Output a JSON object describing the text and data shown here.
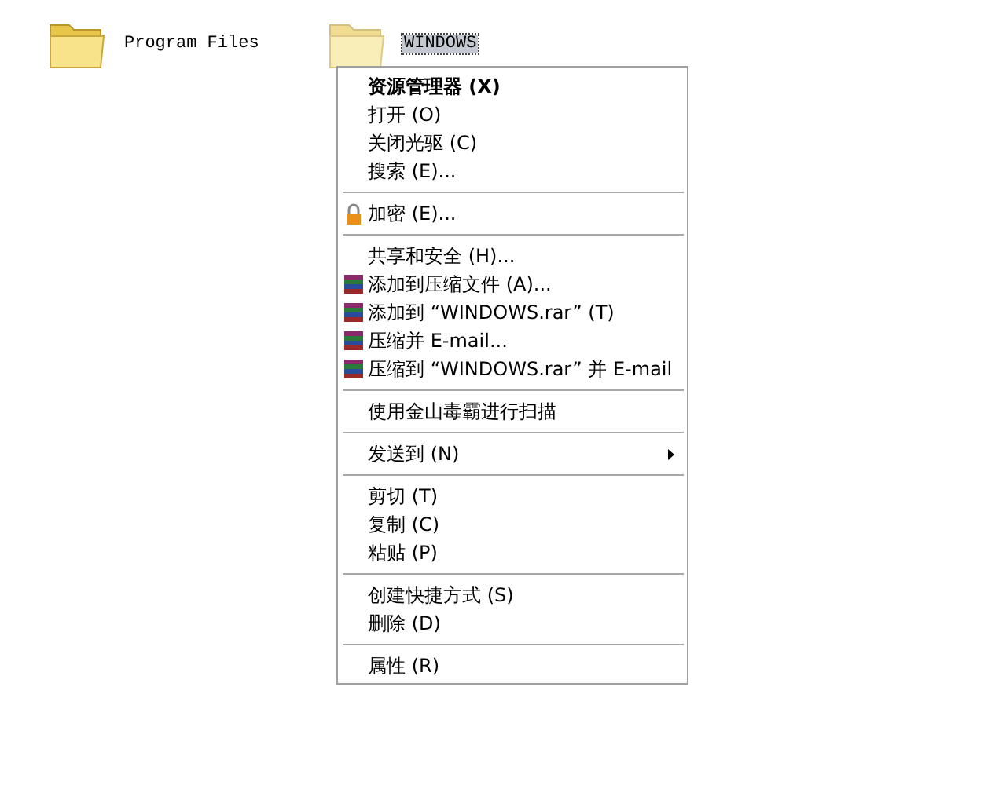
{
  "desktop_items": [
    {
      "label": "Program Files",
      "selected": false
    },
    {
      "label": "WINDOWS",
      "selected": true
    }
  ],
  "context_menu": {
    "items": [
      {
        "kind": "default",
        "label": "资源管理器 (X)"
      },
      {
        "kind": "item",
        "label": "打开 (O)"
      },
      {
        "kind": "item",
        "label": "关闭光驱 (C)"
      },
      {
        "kind": "item",
        "label": "搜索 (E)..."
      },
      {
        "kind": "separator"
      },
      {
        "kind": "lock",
        "label": "加密 (E)..."
      },
      {
        "kind": "separator"
      },
      {
        "kind": "item",
        "label": "共享和安全 (H)..."
      },
      {
        "kind": "archive",
        "label": "添加到压缩文件 (A)..."
      },
      {
        "kind": "archive",
        "label": "添加到 “WINDOWS.rar” (T)"
      },
      {
        "kind": "archive",
        "label": "压缩并 E-mail..."
      },
      {
        "kind": "archive",
        "label": "压缩到 “WINDOWS.rar” 并 E-mail"
      },
      {
        "kind": "separator"
      },
      {
        "kind": "item",
        "label": "使用金山毒霸进行扫描"
      },
      {
        "kind": "separator"
      },
      {
        "kind": "submenu",
        "label": "发送到 (N)"
      },
      {
        "kind": "separator"
      },
      {
        "kind": "item",
        "label": "剪切 (T)"
      },
      {
        "kind": "item",
        "label": "复制 (C)"
      },
      {
        "kind": "item",
        "label": "粘贴 (P)"
      },
      {
        "kind": "separator"
      },
      {
        "kind": "item",
        "label": "创建快捷方式 (S)"
      },
      {
        "kind": "item",
        "label": "删除 (D)"
      },
      {
        "kind": "separator"
      },
      {
        "kind": "item",
        "label": "属性 (R)"
      }
    ]
  }
}
